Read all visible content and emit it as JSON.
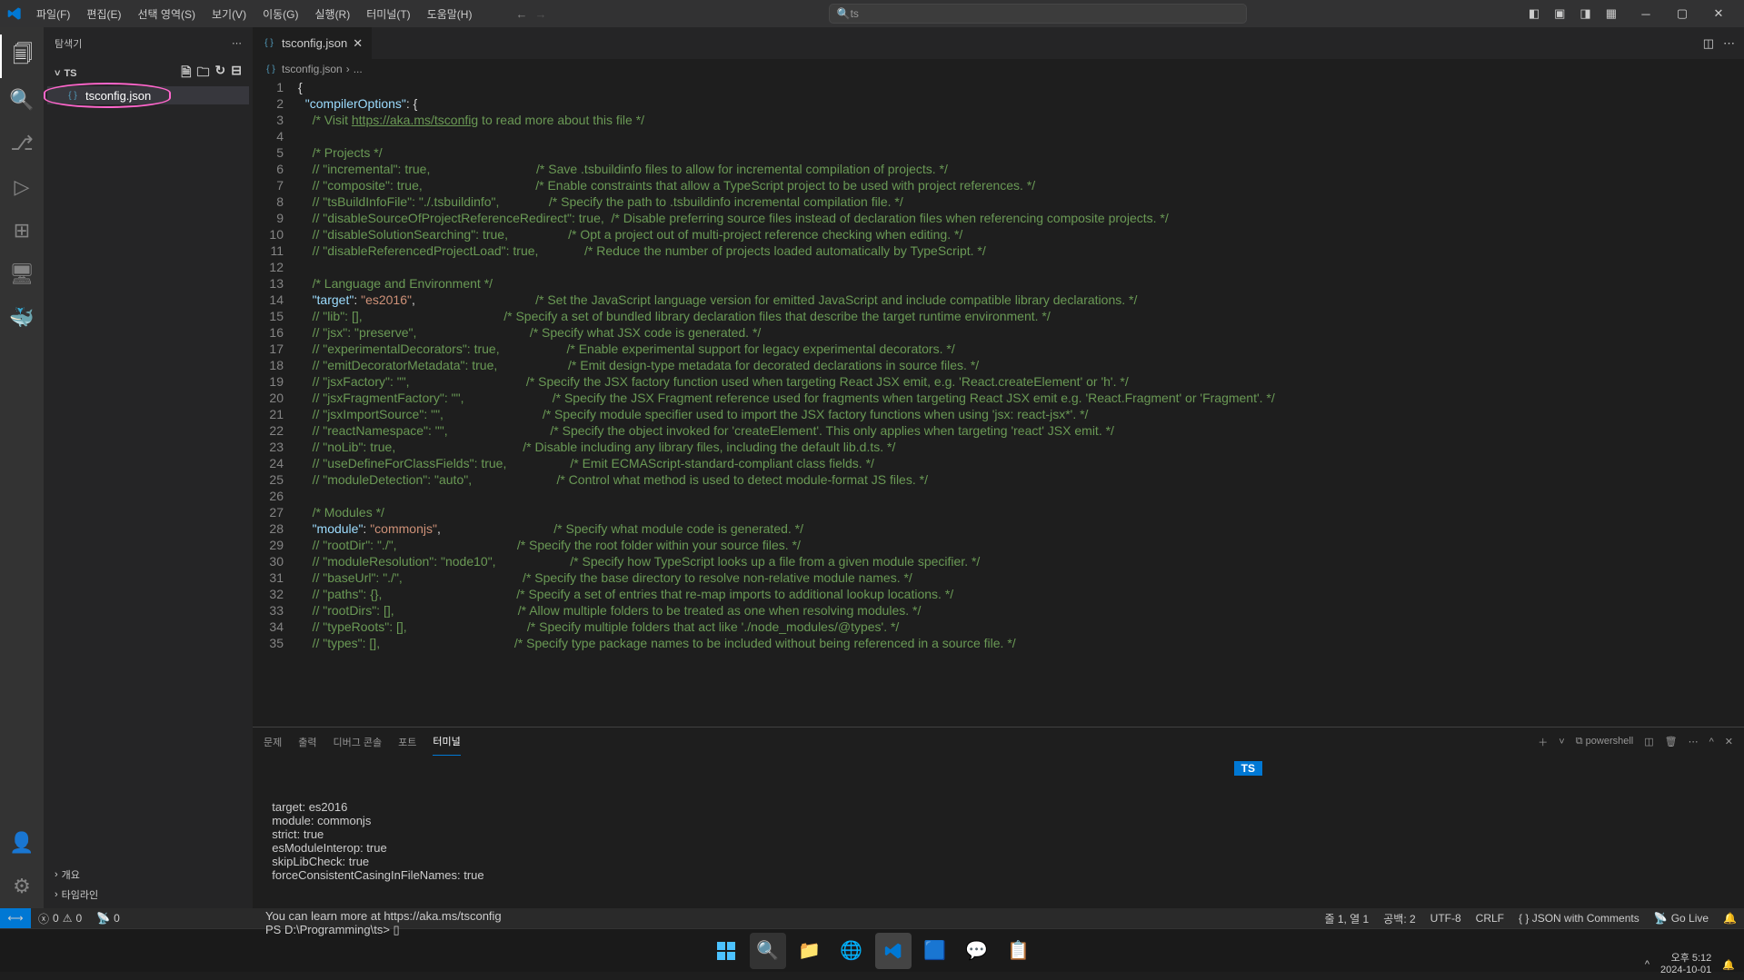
{
  "menu": {
    "items": [
      "파일(F)",
      "편집(E)",
      "선택 영역(S)",
      "보기(V)",
      "이동(G)",
      "실행(R)",
      "터미널(T)",
      "도움말(H)"
    ]
  },
  "search": {
    "text": "ts"
  },
  "sidebar": {
    "title": "탐색기",
    "section": "TS",
    "file": "tsconfig.json",
    "outline": "개요",
    "timeline": "타임라인"
  },
  "tab": {
    "name": "tsconfig.json"
  },
  "breadcrumb": {
    "a": "tsconfig.json",
    "b": "..."
  },
  "code": {
    "l1": "{",
    "l2a": "\"compilerOptions\"",
    "l2b": ": ",
    "l2c": "{",
    "l3a": "/* Visit ",
    "l3b": "https://aka.ms/tsconfig",
    "l3c": " to read more about this file */",
    "l5": "/* Projects */",
    "l6": "// \"incremental\": true,                              /* Save .tsbuildinfo files to allow for incremental compilation of projects. */",
    "l7": "// \"composite\": true,                                /* Enable constraints that allow a TypeScript project to be used with project references. */",
    "l8": "// \"tsBuildInfoFile\": \"./.tsbuildinfo\",              /* Specify the path to .tsbuildinfo incremental compilation file. */",
    "l9": "// \"disableSourceOfProjectReferenceRedirect\": true,  /* Disable preferring source files instead of declaration files when referencing composite projects. */",
    "l10": "// \"disableSolutionSearching\": true,                 /* Opt a project out of multi-project reference checking when editing. */",
    "l11": "// \"disableReferencedProjectLoad\": true,             /* Reduce the number of projects loaded automatically by TypeScript. */",
    "l13": "/* Language and Environment */",
    "l14a": "\"target\"",
    "l14b": ": ",
    "l14c": "\"es2016\"",
    "l14d": ",",
    "l14e": "/* Set the JavaScript language version for emitted JavaScript and include compatible library declarations. */",
    "l15": "// \"lib\": [],                                        /* Specify a set of bundled library declaration files that describe the target runtime environment. */",
    "l16": "// \"jsx\": \"preserve\",                                /* Specify what JSX code is generated. */",
    "l17": "// \"experimentalDecorators\": true,                   /* Enable experimental support for legacy experimental decorators. */",
    "l18": "// \"emitDecoratorMetadata\": true,                    /* Emit design-type metadata for decorated declarations in source files. */",
    "l19": "// \"jsxFactory\": \"\",                                 /* Specify the JSX factory function used when targeting React JSX emit, e.g. 'React.createElement' or 'h'. */",
    "l20": "// \"jsxFragmentFactory\": \"\",                         /* Specify the JSX Fragment reference used for fragments when targeting React JSX emit e.g. 'React.Fragment' or 'Fragment'. */",
    "l21": "// \"jsxImportSource\": \"\",                            /* Specify module specifier used to import the JSX factory functions when using 'jsx: react-jsx*'. */",
    "l22": "// \"reactNamespace\": \"\",                             /* Specify the object invoked for 'createElement'. This only applies when targeting 'react' JSX emit. */",
    "l23": "// \"noLib\": true,                                    /* Disable including any library files, including the default lib.d.ts. */",
    "l24": "// \"useDefineForClassFields\": true,                  /* Emit ECMAScript-standard-compliant class fields. */",
    "l25": "// \"moduleDetection\": \"auto\",                        /* Control what method is used to detect module-format JS files. */",
    "l27": "/* Modules */",
    "l28a": "\"module\"",
    "l28b": ": ",
    "l28c": "\"commonjs\"",
    "l28d": ",",
    "l28e": "/* Specify what module code is generated. */",
    "l29": "// \"rootDir\": \"./\",                                  /* Specify the root folder within your source files. */",
    "l30": "// \"moduleResolution\": \"node10\",                     /* Specify how TypeScript looks up a file from a given module specifier. */",
    "l31": "// \"baseUrl\": \"./\",                                  /* Specify the base directory to resolve non-relative module names. */",
    "l32": "// \"paths\": {},                                      /* Specify a set of entries that re-map imports to additional lookup locations. */",
    "l33": "// \"rootDirs\": [],                                   /* Allow multiple folders to be treated as one when resolving modules. */",
    "l34": "// \"typeRoots\": [],                                  /* Specify multiple folders that act like './node_modules/@types'. */",
    "l35": "// \"types\": [],                                      /* Specify type package names to be included without being referenced in a source file. */"
  },
  "panel": {
    "tabs": [
      "문제",
      "출력",
      "디버그 콘솔",
      "포트",
      "터미널"
    ],
    "shell": "powershell",
    "term": "  target: es2016\n  module: commonjs\n  strict: true\n  esModuleInterop: true\n  skipLibCheck: true\n  forceConsistentCasingInFileNames: true\n\n\nYou can learn more at https://aka.ms/tsconfig\nPS D:\\Programming\\ts> ▯",
    "badge": "TS"
  },
  "status": {
    "errors": "0",
    "warnings": "0",
    "port": "0",
    "pos": "줄 1, 열 1",
    "spaces": "공백: 2",
    "enc": "UTF-8",
    "eol": "CRLF",
    "lang": "{ }  JSON with Comments",
    "golive": "Go Live",
    "bell": "🔔"
  },
  "clock": {
    "time": "오후 5:12",
    "date": "2024-10-01"
  }
}
